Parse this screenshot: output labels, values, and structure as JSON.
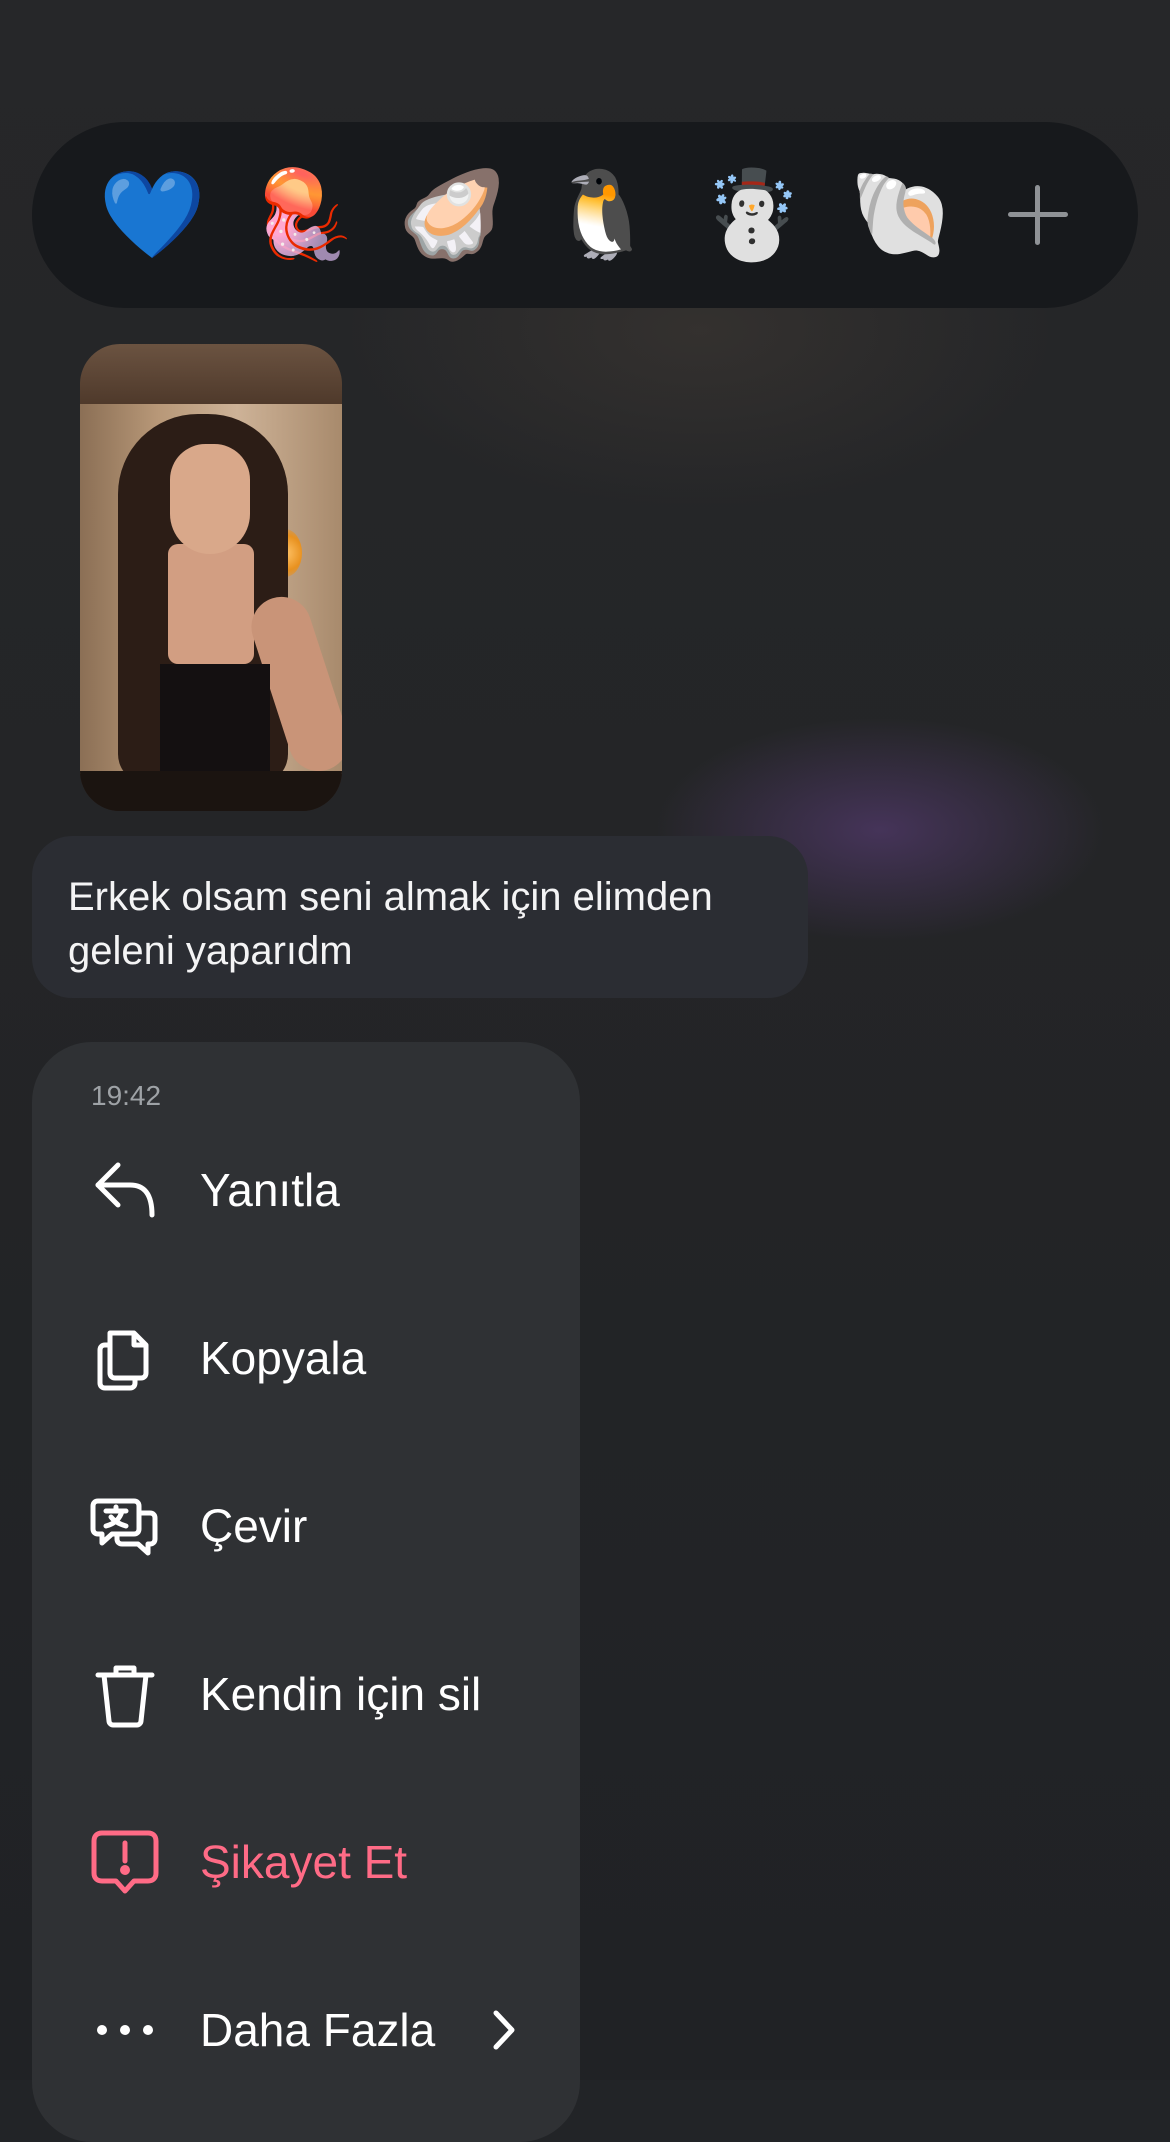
{
  "reactions": {
    "emojis": [
      {
        "glyph": "💙",
        "name": "blue-heart"
      },
      {
        "glyph": "🪼",
        "name": "jellyfish"
      },
      {
        "glyph": "🦪",
        "name": "oyster"
      },
      {
        "glyph": "🐧",
        "name": "penguin"
      },
      {
        "glyph": "☃️",
        "name": "snowman"
      },
      {
        "glyph": "🐚",
        "name": "spiral-shell"
      }
    ],
    "more_icon": "plus-icon"
  },
  "message": {
    "text": "Erkek olsam seni almak için elimden\ngeleni yaparıdm"
  },
  "menu": {
    "timestamp": "19:42",
    "items": [
      {
        "label": "Yanıtla",
        "icon": "reply-icon"
      },
      {
        "label": "Kopyala",
        "icon": "copy-icon"
      },
      {
        "label": "Çevir",
        "icon": "translate-icon"
      },
      {
        "label": "Kendin için sil",
        "icon": "trash-icon"
      },
      {
        "label": "Şikayet Et",
        "icon": "report-icon"
      },
      {
        "label": "Daha Fazla",
        "icon": "more-icon"
      }
    ]
  },
  "colors": {
    "background": "#222427",
    "reaction_bar": "#17191c",
    "bubble": "#2b2d33",
    "menu": "#2f3134",
    "danger": "#ff6b86"
  }
}
